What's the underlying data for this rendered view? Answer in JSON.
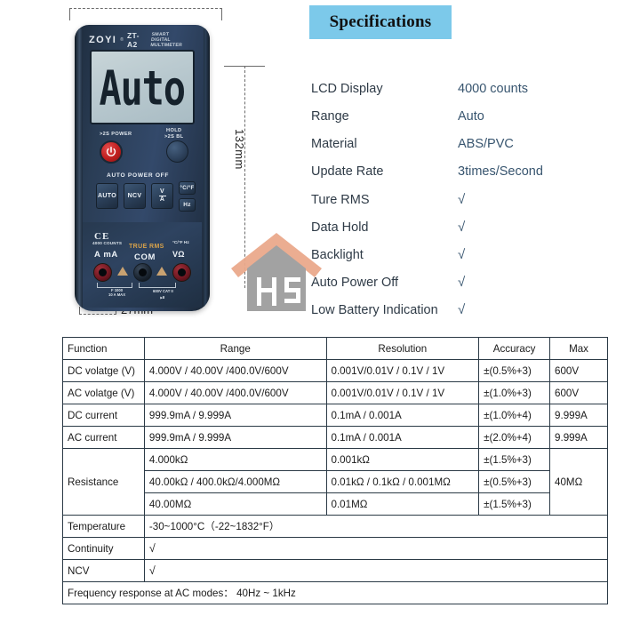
{
  "banner": {
    "title": "Specifications"
  },
  "spec_list": [
    {
      "key": "LCD Display",
      "value": "4000 counts",
      "is_check": false
    },
    {
      "key": "Range",
      "value": "Auto",
      "is_check": false
    },
    {
      "key": "Material",
      "value": "ABS/PVC",
      "is_check": false
    },
    {
      "key": "Update Rate",
      "value": "3times/Second",
      "is_check": false
    },
    {
      "key": "Ture RMS",
      "value": "√",
      "is_check": true
    },
    {
      "key": "Data Hold",
      "value": "√",
      "is_check": true
    },
    {
      "key": "Backlight",
      "value": "√",
      "is_check": true
    },
    {
      "key": "Auto Power Off",
      "value": "√",
      "is_check": true
    },
    {
      "key": "Low Battery Indication",
      "value": "√",
      "is_check": true
    }
  ],
  "dimensions": {
    "height_label": "132mm",
    "width_label": "27mm"
  },
  "device": {
    "brand": "ZOYI",
    "brand_reg": "®",
    "model": "ZT-A2",
    "subtitle_line1": "SMART",
    "subtitle_line2": "DIGITAL MULTIMETER",
    "lcd_text": "Auto",
    "power_label": ">2S POWER",
    "hold_label_line1": "HOLD",
    "hold_label_line2": ">2S  BL",
    "auto_power_off_label": "AUTO POWER OFF",
    "buttons": {
      "auto": "AUTO",
      "ncv": "NCV",
      "a_over_v_top": "V",
      "a_over_v_bottom": "A",
      "cf": "°C/°F",
      "hz": "Hz"
    },
    "ce_mark": "CE",
    "ce_sub": "4000 COUNTS",
    "true_rms": "TRUE RMS",
    "jack_a_label": "A mA",
    "jack_com_label": "COM",
    "jack_v_label": "VΩ",
    "jack_v_top_label_1": "°C/°F Hz",
    "fuse1_line1": "F 1000",
    "fuse1_line2": "10 A MAX",
    "fuse2_line1": "600V",
    "fuse2_line2": "CAT II"
  },
  "watermark": {
    "letters": "HS"
  },
  "table": {
    "headers": [
      "Function",
      "Range",
      "Resolution",
      "Accuracy",
      "Max"
    ],
    "rows": [
      {
        "function": "DC volatge (V)",
        "range": "4.000V / 40.00V /400.0V/600V",
        "resolution": "0.001V/0.01V / 0.1V / 1V",
        "accuracy": "±(0.5%+3)",
        "max": "600V"
      },
      {
        "function": "AC volatge (V)",
        "range": "4.000V / 40.00V /400.0V/600V",
        "resolution": "0.001V/0.01V / 0.1V / 1V",
        "accuracy": "±(1.0%+3)",
        "max": "600V"
      },
      {
        "function": "DC current",
        "range": "999.9mA / 9.999A",
        "resolution": "0.1mA / 0.001A",
        "accuracy": "±(1.0%+4)",
        "max": "9.999A"
      },
      {
        "function": "AC current",
        "range": "999.9mA / 9.999A",
        "resolution": "0.1mA / 0.001A",
        "accuracy": "±(2.0%+4)",
        "max": "9.999A"
      }
    ],
    "resistance": {
      "function": "Resistance",
      "max": "40MΩ",
      "subrows": [
        {
          "range": "4.000kΩ",
          "resolution": "0.001kΩ",
          "accuracy": "±(1.5%+3)"
        },
        {
          "range": "40.00kΩ / 400.0kΩ/4.000MΩ",
          "resolution": "0.01kΩ / 0.1kΩ / 0.001MΩ",
          "accuracy": "±(0.5%+3)"
        },
        {
          "range": "40.00MΩ",
          "resolution": "0.01MΩ",
          "accuracy": "±(1.5%+3)"
        }
      ]
    },
    "temperature": {
      "function": "Temperature",
      "value": "-30~1000°C（-22~1832°F）"
    },
    "continuity": {
      "function": "Continuity",
      "value": "√"
    },
    "ncv": {
      "function": "NCV",
      "value": "√"
    },
    "footer": "Frequency response at AC modes：  40Hz ~ 1kHz"
  },
  "colors": {
    "banner_bg": "#7cc9ea",
    "spec_value_text": "#38556f",
    "table_border": "#2b3a46",
    "device_body": "#2a3d55",
    "power_button": "#c01f1f"
  }
}
